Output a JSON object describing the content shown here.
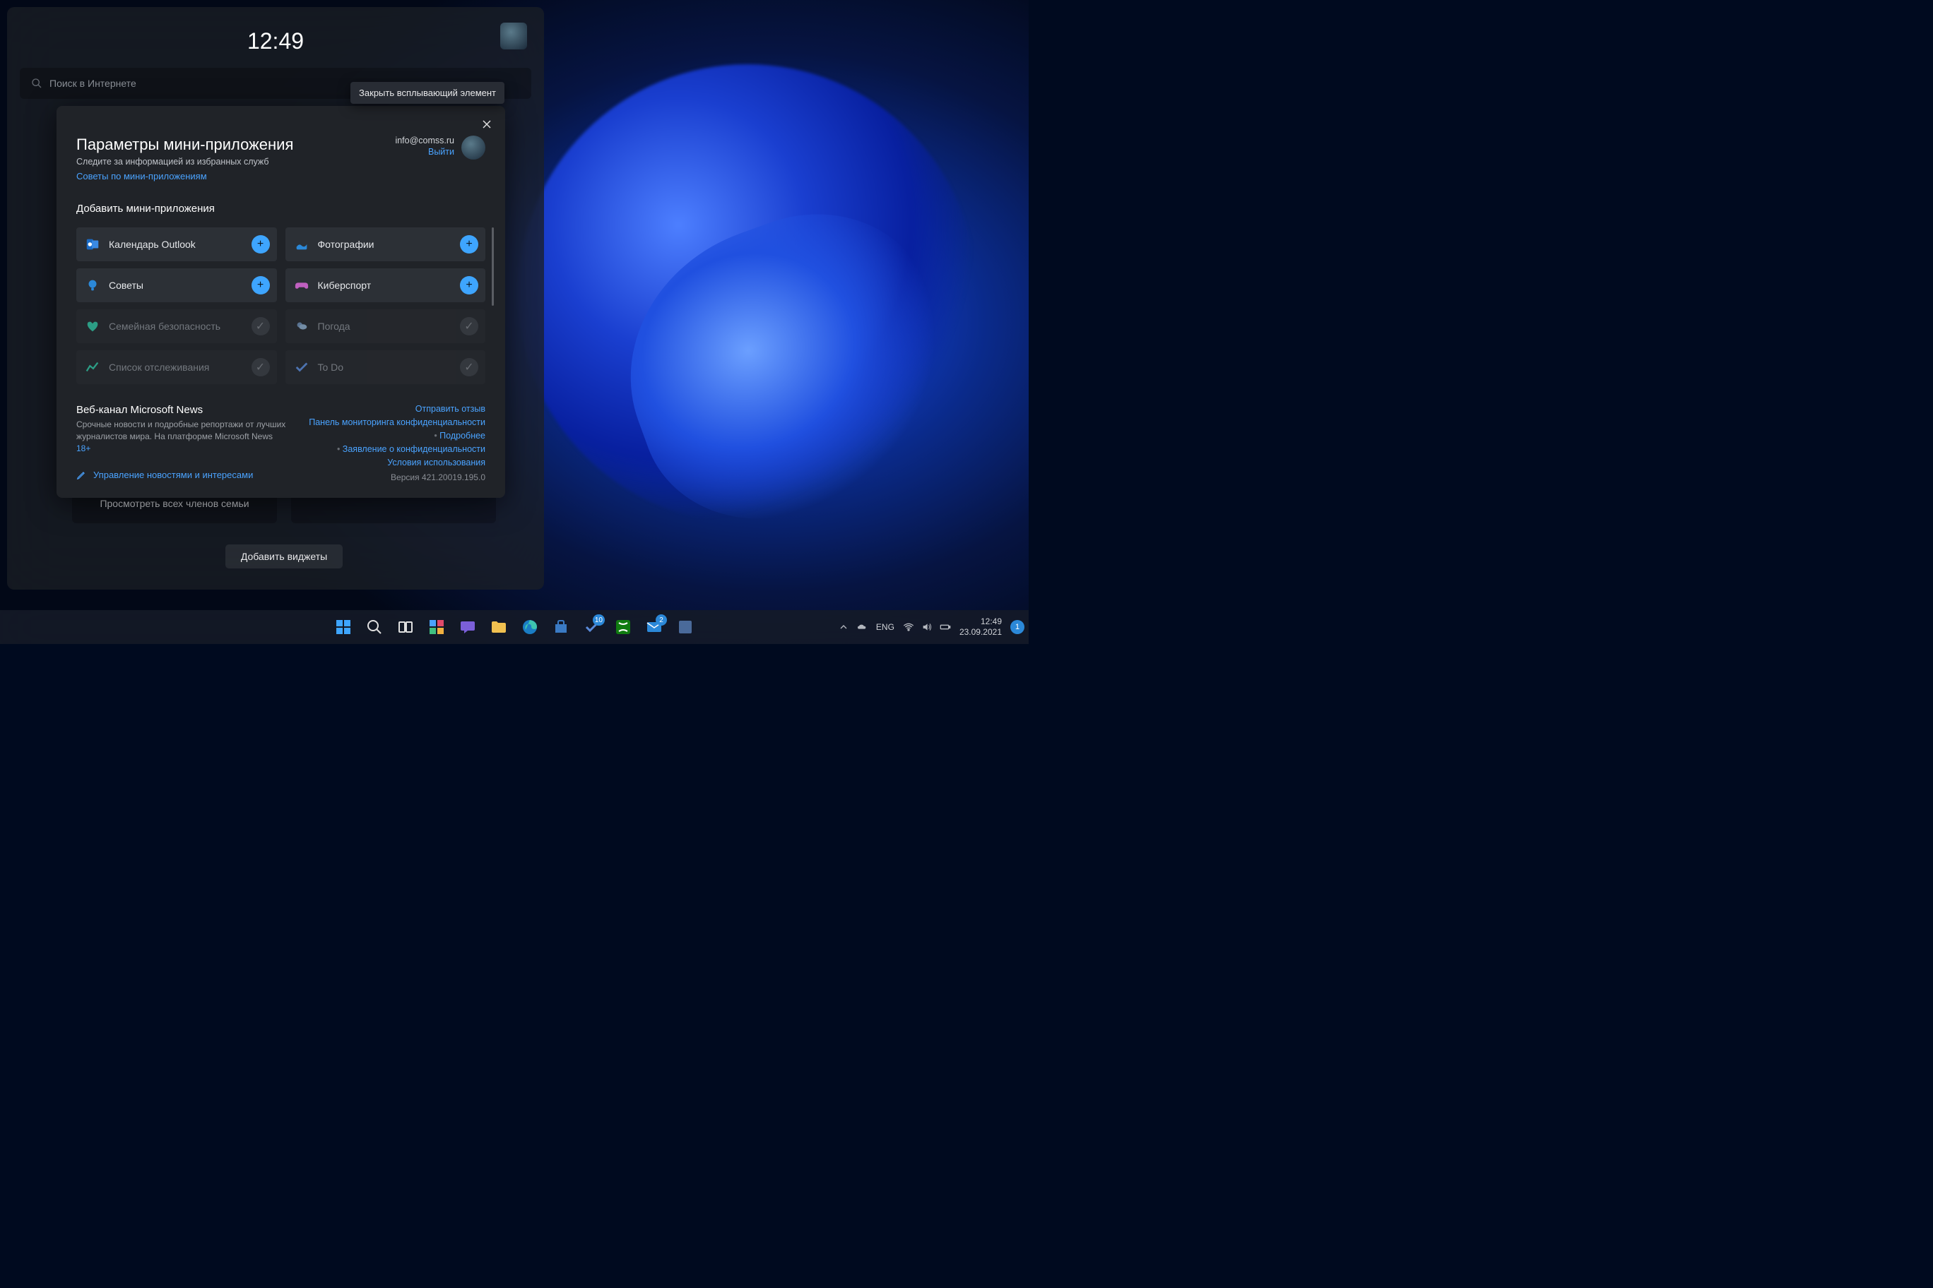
{
  "widgets_panel": {
    "clock": "12:49",
    "search_placeholder": "Поиск в Интернете",
    "bg_card_left": "Просмотреть всех членов семьи",
    "add_widgets_btn": "Добавить виджеты"
  },
  "tooltip": "Закрыть всплывающий элемент",
  "settings": {
    "title": "Параметры мини-приложения",
    "subtitle": "Следите за информацией из избранных служб",
    "tips_link": "Советы по мини-приложениям",
    "email": "info@comss.ru",
    "logout": "Выйти",
    "add_section": "Добавить мини-приложения",
    "tiles": [
      {
        "label": "Календарь Outlook",
        "enabled": true,
        "icon": "outlook",
        "color": "#2b88d8"
      },
      {
        "label": "Фотографии",
        "enabled": true,
        "icon": "photos",
        "color": "#2b88d8"
      },
      {
        "label": "Советы",
        "enabled": true,
        "icon": "tips",
        "color": "#2b88d8"
      },
      {
        "label": "Киберспорт",
        "enabled": true,
        "icon": "esports",
        "color": "#c060c0"
      },
      {
        "label": "Семейная безопасность",
        "enabled": false,
        "icon": "family",
        "color": "#30c0a0"
      },
      {
        "label": "Погода",
        "enabled": false,
        "icon": "weather",
        "color": "#6a8ab0"
      },
      {
        "label": "Список отслеживания",
        "enabled": false,
        "icon": "watchlist",
        "color": "#30c0a0"
      },
      {
        "label": "To Do",
        "enabled": false,
        "icon": "todo",
        "color": "#5a8ad8"
      }
    ],
    "news_title": "Веб-канал Microsoft News",
    "news_desc_a": "Срочные новости и подробные репортажи от лучших журналистов мира. На платформе Microsoft News ",
    "news_desc_b": "18+",
    "news_manage": "Управление новостями и интересами",
    "links": {
      "feedback": "Отправить отзыв",
      "privacy_dash": "Панель мониторинга конфиденциальности",
      "more": "Подробнее",
      "privacy_stmt": "Заявление о конфиденциальности",
      "terms": "Условия использования"
    },
    "version": "Версия 421.20019.195.0"
  },
  "taskbar": {
    "lang": "ENG",
    "time": "12:49",
    "date": "23.09.2021",
    "notif_count": "1",
    "badges": {
      "todo": "10",
      "mail": "2"
    }
  }
}
